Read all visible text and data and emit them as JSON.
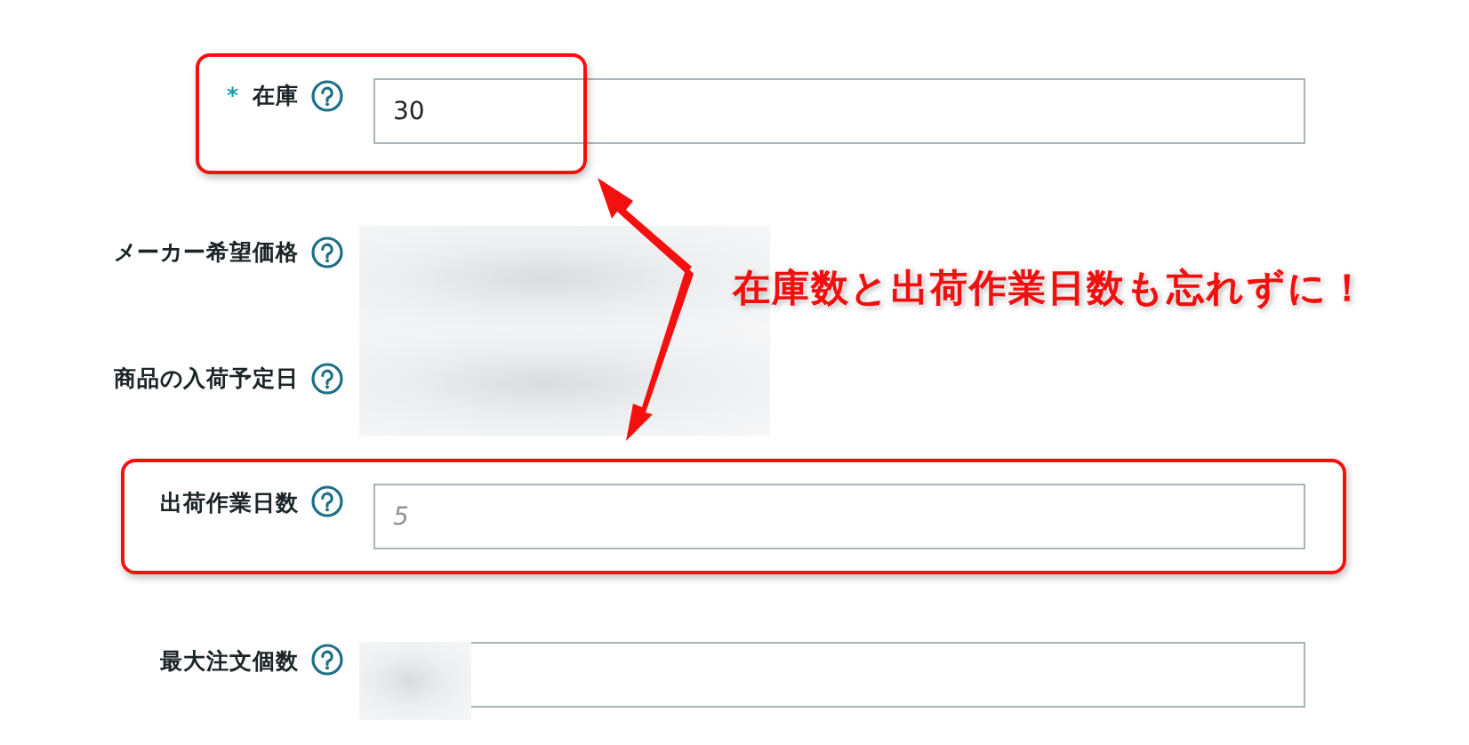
{
  "form": {
    "rows": [
      {
        "required_mark": "*",
        "label": "在庫",
        "kind": "field",
        "value": "30",
        "highlighted": true
      },
      {
        "label": "メーカー希望価格",
        "kind": "redacted",
        "highlighted": false
      },
      {
        "label": "商品の入荷予定日",
        "kind": "redacted",
        "highlighted": false
      },
      {
        "label": "出荷作業日数",
        "kind": "field",
        "placeholder": "5",
        "highlighted": true
      },
      {
        "label": "最大注文個数",
        "kind": "field",
        "value_redacted": true,
        "highlighted": false
      }
    ]
  },
  "annotation": {
    "text": "在庫数と出荷作業日数も忘れずに！"
  }
}
